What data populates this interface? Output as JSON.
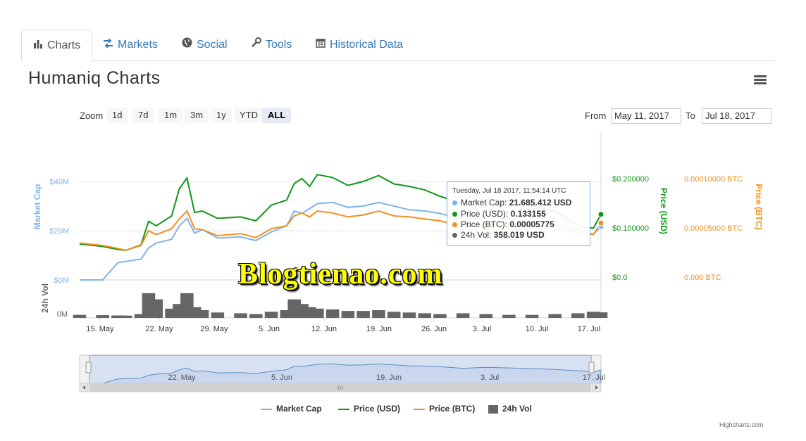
{
  "tabs": [
    {
      "label": "Charts",
      "icon": "bar-chart-icon",
      "active": true
    },
    {
      "label": "Markets",
      "icon": "exchange-icon",
      "active": false
    },
    {
      "label": "Social",
      "icon": "globe-icon",
      "active": false
    },
    {
      "label": "Tools",
      "icon": "wrench-icon",
      "active": false
    },
    {
      "label": "Historical Data",
      "icon": "calendar-icon",
      "active": false
    }
  ],
  "page_title": "Humaniq Charts",
  "zoom": {
    "label": "Zoom",
    "buttons": [
      "1d",
      "7d",
      "1m",
      "3m",
      "1y",
      "YTD",
      "ALL"
    ],
    "active": "ALL"
  },
  "range": {
    "from_label": "From",
    "from_value": "May 11, 2017",
    "to_label": "To",
    "to_value": "Jul 18, 2017"
  },
  "watermark": "Blogtienao.com",
  "tooltip": {
    "title": "Tuesday, Jul 18 2017, 11:54:14 UTC",
    "rows": [
      {
        "label": "Market Cap:",
        "value": "21.685.412 USD",
        "color": "#7cb5ec"
      },
      {
        "label": "Price (USD):",
        "value": "0.133155",
        "color": "#109618"
      },
      {
        "label": "Price (BTC):",
        "value": "0.00005775",
        "color": "#f28f1f"
      },
      {
        "label": "24h Vol:",
        "value": "358.019 USD",
        "color": "#666666"
      }
    ]
  },
  "legend": [
    {
      "label": "Market Cap",
      "color": "#7cb5ec",
      "type": "line"
    },
    {
      "label": "Price (USD)",
      "color": "#109618",
      "type": "line"
    },
    {
      "label": "Price (BTC)",
      "color": "#f28f1f",
      "type": "line"
    },
    {
      "label": "24h Vol",
      "color": "#666666",
      "type": "column"
    }
  ],
  "credits": "Highcharts.com",
  "chart_data": {
    "type": "line",
    "x": [
      "2017-05-11",
      "2017-05-14",
      "2017-05-16",
      "2017-05-17",
      "2017-05-19",
      "2017-05-20",
      "2017-05-21",
      "2017-05-23",
      "2017-05-24",
      "2017-05-25",
      "2017-05-26",
      "2017-05-27",
      "2017-05-29",
      "2017-06-01",
      "2017-06-03",
      "2017-06-05",
      "2017-06-07",
      "2017-06-08",
      "2017-06-09",
      "2017-06-10",
      "2017-06-11",
      "2017-06-13",
      "2017-06-15",
      "2017-06-17",
      "2017-06-19",
      "2017-06-21",
      "2017-06-23",
      "2017-06-25",
      "2017-06-27",
      "2017-06-30",
      "2017-07-03",
      "2017-07-06",
      "2017-07-09",
      "2017-07-12",
      "2017-07-15",
      "2017-07-17",
      "2017-07-18"
    ],
    "series": [
      {
        "name": "Market Cap",
        "axis": "Market Cap",
        "unit": "USD",
        "color": "#7cb5ec",
        "values": [
          0,
          0,
          7000000,
          7500000,
          8500000,
          13000000,
          15000000,
          16500000,
          22000000,
          25000000,
          19000000,
          20500000,
          17000000,
          17500000,
          16000000,
          19500000,
          22000000,
          28000000,
          27000000,
          29000000,
          31000000,
          31500000,
          29500000,
          30000000,
          31500000,
          30000000,
          28500000,
          28000000,
          27000000,
          24500000,
          26000000,
          25000000,
          24000000,
          22500000,
          20500000,
          18500000,
          21685412
        ]
      },
      {
        "name": "Price (USD)",
        "axis": "Price (USD)",
        "unit": "USD",
        "color": "#109618",
        "values": [
          0.073,
          0.068,
          0.062,
          0.06,
          0.071,
          0.119,
          0.11,
          0.13,
          0.185,
          0.207,
          0.137,
          0.14,
          0.125,
          0.128,
          0.12,
          0.152,
          0.162,
          0.196,
          0.206,
          0.19,
          0.214,
          0.208,
          0.192,
          0.2,
          0.212,
          0.195,
          0.19,
          0.183,
          0.17,
          0.155,
          0.165,
          0.16,
          0.15,
          0.14,
          0.11,
          0.105,
          0.133155
        ]
      },
      {
        "name": "Price (BTC)",
        "axis": "Price (BTC)",
        "unit": "BTC",
        "color": "#f28f1f",
        "values": [
          3.75e-05,
          3.5e-05,
          3.2e-05,
          3e-05,
          3.5e-05,
          5e-05,
          4.6e-05,
          5.2e-05,
          6.2e-05,
          7e-05,
          5.2e-05,
          5.1e-05,
          4.5e-05,
          4.7e-05,
          4.3e-05,
          5.2e-05,
          5.5e-05,
          6.5e-05,
          6.8e-05,
          6.4e-05,
          7e-05,
          6.8e-05,
          6.4e-05,
          6.6e-05,
          7e-05,
          6.5e-05,
          6.4e-05,
          6.2e-05,
          6e-05,
          5.4e-05,
          5.7e-05,
          5.6e-05,
          5.5e-05,
          5.2e-05,
          4.8e-05,
          4.6e-05,
          5.775e-05
        ]
      },
      {
        "name": "24h Vol",
        "axis": "24h Vol",
        "unit": "USD",
        "color": "#666666",
        "values": [
          200000,
          180000,
          160000,
          150000,
          250000,
          1600000,
          1200000,
          600000,
          900000,
          1600000,
          700000,
          500000,
          350000,
          300000,
          250000,
          400000,
          500000,
          1200000,
          900000,
          700000,
          600000,
          550000,
          450000,
          450000,
          500000,
          400000,
          350000,
          300000,
          250000,
          300000,
          250000,
          200000,
          200000,
          250000,
          300000,
          400000,
          358019
        ]
      }
    ],
    "axes": {
      "market_cap": {
        "title": "Market Cap",
        "ticks": [
          "$0M",
          "$20M",
          "$40M"
        ],
        "range": [
          0,
          40000000
        ]
      },
      "price_usd": {
        "title": "Price (USD)",
        "ticks": [
          "$0.0",
          "$0.100000",
          "$0.200000"
        ],
        "range": [
          0,
          0.2
        ]
      },
      "price_btc": {
        "title": "Price (BTC)",
        "ticks": [
          "0.000 BTC",
          "0.00005000 BTC",
          "0.00010000 BTC"
        ],
        "range": [
          0,
          0.0001
        ]
      },
      "volume": {
        "title": "24h Vol",
        "ticks": [
          "0M"
        ],
        "range": [
          0,
          2000000
        ]
      },
      "x": {
        "ticks": [
          "15. May",
          "22. May",
          "29. May",
          "5. Jun",
          "12. Jun",
          "19. Jun",
          "26. Jun",
          "3. Jul",
          "10. Jul",
          "17. Jul"
        ]
      }
    },
    "navigator": {
      "ticks": [
        "22. May",
        "5. Jun",
        "19. Jun",
        "3. Jul",
        "17. Jul"
      ]
    },
    "grid": true
  }
}
